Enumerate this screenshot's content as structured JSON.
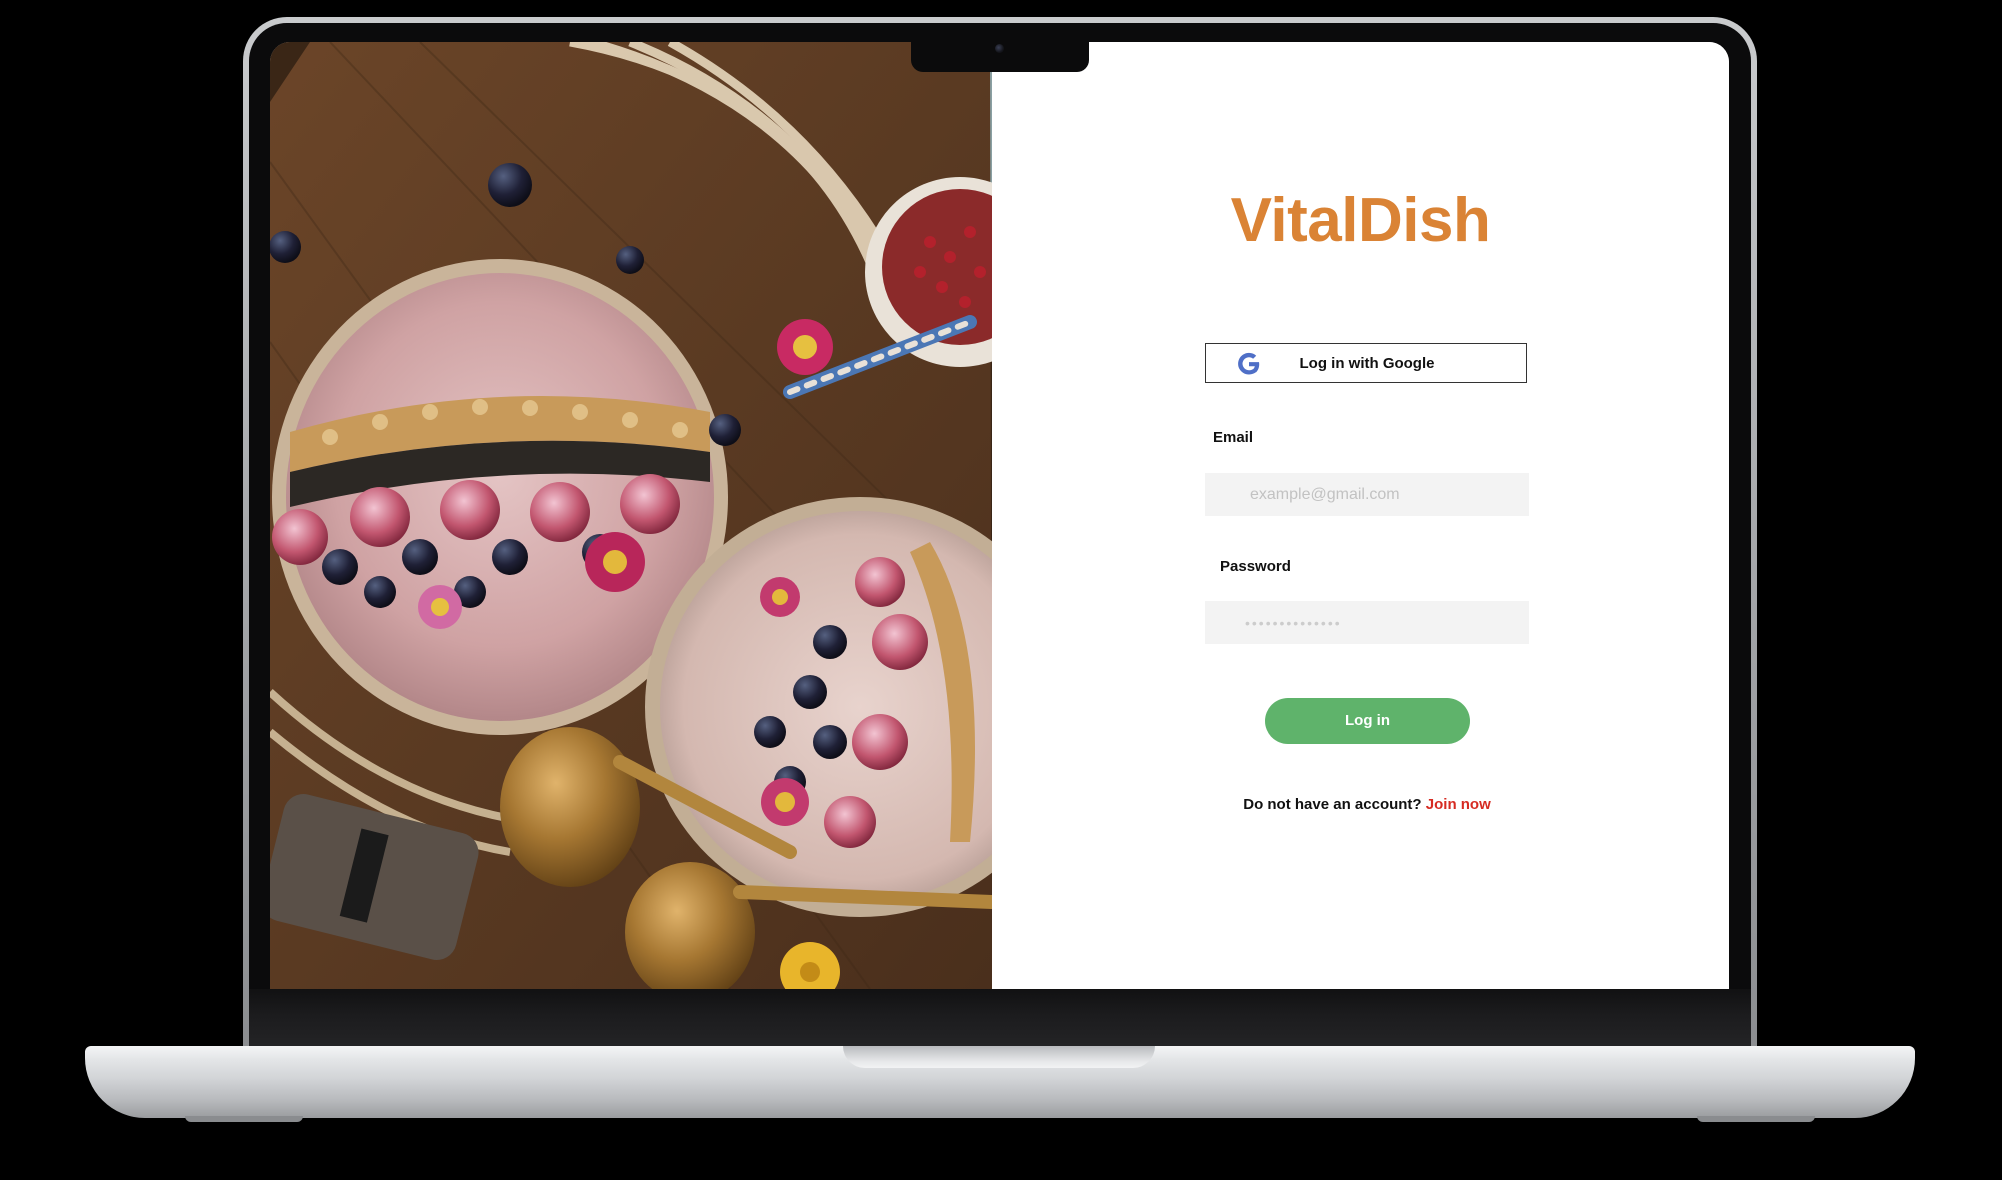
{
  "app": {
    "brand_name": "VitalDish",
    "brand_color": "#da8335"
  },
  "hero_image": {
    "description_icon": "acai-bowls-photo"
  },
  "login_form": {
    "google_button_label": "Log in with Google",
    "google_icon": "google-g-icon",
    "email_label": "Email",
    "email_placeholder": "example@gmail.com",
    "password_label": "Password",
    "password_placeholder": "••••••••••••••",
    "submit_label": "Log in",
    "submit_color": "#5fb36b",
    "signup_prompt": "Do not have an account?",
    "signup_link": "Join now",
    "signup_link_color": "#d62b22"
  }
}
